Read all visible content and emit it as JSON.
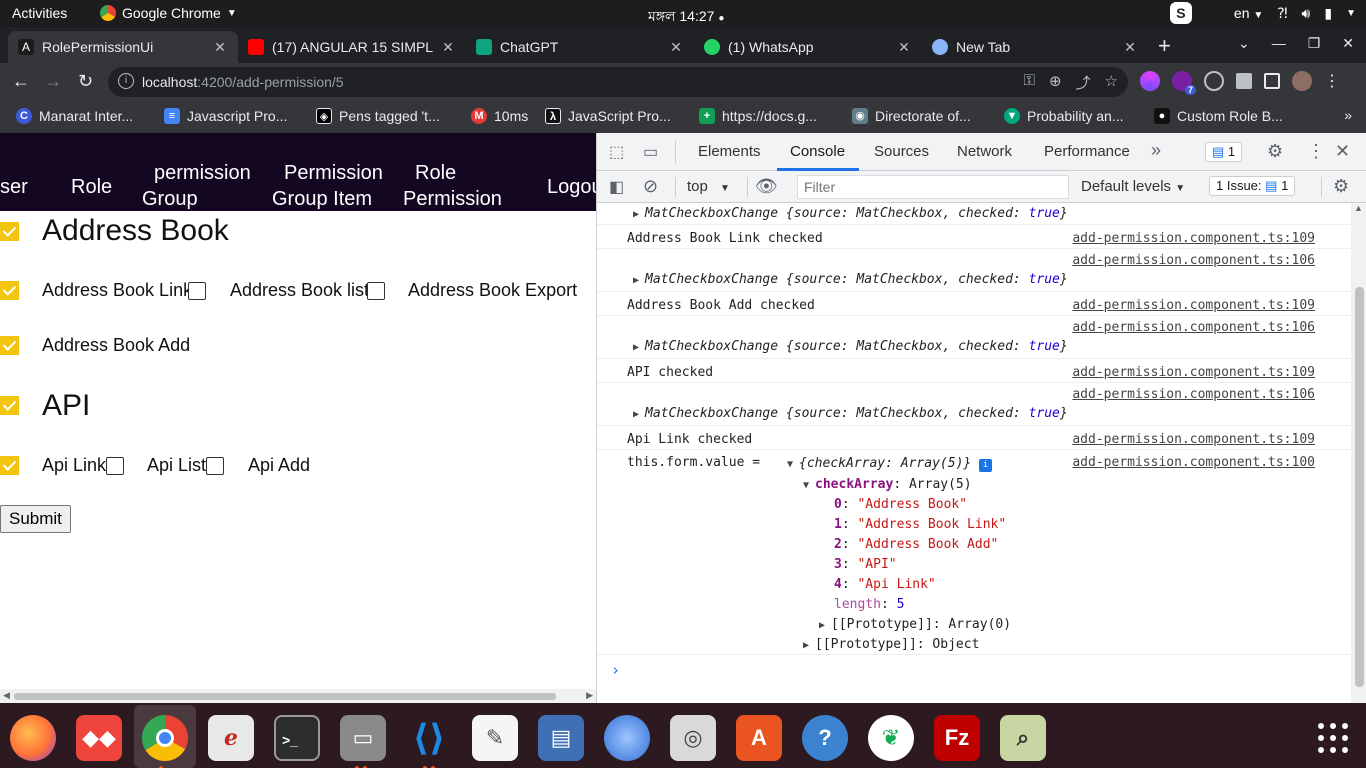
{
  "system": {
    "activities": "Activities",
    "app_name": "Google Chrome",
    "clock": "মঙ্গল 14:27",
    "lang": "en",
    "s_badge": "S"
  },
  "tabs": [
    {
      "title": "RolePermissionUi",
      "favicon": "angular-icon",
      "color": "#c3002f"
    },
    {
      "title": "(17) ANGULAR 15 SIMPL",
      "favicon": "youtube-icon",
      "color": "#ff0000"
    },
    {
      "title": "ChatGPT",
      "favicon": "chatgpt-icon",
      "color": "#10a37f"
    },
    {
      "title": "(1) WhatsApp",
      "favicon": "whatsapp-icon",
      "color": "#25d366"
    },
    {
      "title": "New Tab",
      "favicon": "chrome-icon",
      "color": "#8ab4f8"
    }
  ],
  "toolbar": {
    "url_host": "localhost",
    "url_path": ":4200/add-permission/5",
    "ext_badge": "7"
  },
  "bookmarks": [
    {
      "label": "Manarat Inter...",
      "icon": "C",
      "color": "#3b5bdb"
    },
    {
      "label": "Javascript Pro...",
      "icon": "≡",
      "color": "#4285f4"
    },
    {
      "label": "Pens tagged 't...",
      "icon": "◈",
      "color": "#000000"
    },
    {
      "label": "10ms",
      "icon": "M",
      "color": "#e53935"
    },
    {
      "label": "JavaScript Pro...",
      "icon": "λ",
      "color": "#111111"
    },
    {
      "label": "https://docs.g...",
      "icon": "+",
      "color": "#0f9d58"
    },
    {
      "label": "Directorate of...",
      "icon": "◉",
      "color": "#607d8b"
    },
    {
      "label": "Probability an...",
      "icon": "▼",
      "color": "#00a67e"
    },
    {
      "label": "Custom Role B...",
      "icon": "●",
      "color": "#111111"
    }
  ],
  "app_nav": {
    "user": "ser",
    "role": "Role",
    "permission_group_1": "permission",
    "permission_group_2": "Group",
    "permission_group_item_1": "Permission",
    "permission_group_item_2": "Group Item",
    "role_permission_1": "Role",
    "role_permission_2": "Permission",
    "logout": "Logou"
  },
  "form": {
    "section1_title": "Address Book",
    "address_book_link": "Address Book Link",
    "address_book_list": "Address Book list",
    "address_book_export": "Address Book Export",
    "address_book_add": "Address Book Add",
    "section2_title": "API",
    "api_link": "Api Link",
    "api_list": "Api List",
    "api_add": "Api Add",
    "submit": "Submit"
  },
  "devtools": {
    "tabs": [
      "Elements",
      "Console",
      "Sources",
      "Network",
      "Performance"
    ],
    "active_tab": "Console",
    "message_count": "1",
    "context": "top",
    "filter_placeholder": "Filter",
    "levels": "Default levels",
    "issues": "1 Issue:",
    "issues_count": "1"
  },
  "console": {
    "event_prefix": "MatCheckboxChange",
    "event_body_a": "{source: MatCheckbox, checked: ",
    "event_true": "true",
    "event_close": "}",
    "msg1": "Address Book Link checked",
    "msg2": "Address Book Add checked",
    "msg3": "API checked",
    "msg4": "Api Link checked",
    "src109": "add-permission.component.ts:109",
    "src106": "add-permission.component.ts:106",
    "src100": "add-permission.component.ts:100",
    "form_label": "this.form.value =",
    "obj_summary": "{checkArray: Array(5)}",
    "check_key": "checkArray",
    "check_type": "Array(5)",
    "items": [
      {
        "i": "0",
        "v": "\"Address Book\""
      },
      {
        "i": "1",
        "v": "\"Address Book Link\""
      },
      {
        "i": "2",
        "v": "\"Address Book Add\""
      },
      {
        "i": "3",
        "v": "\"API\""
      },
      {
        "i": "4",
        "v": "\"Api Link\""
      }
    ],
    "length_key": "length",
    "length_val": "5",
    "proto_array": "[[Prototype]]: Array(0)",
    "proto_object": "[[Prototype]]: Object"
  },
  "dock": [
    {
      "name": "firefox-icon",
      "color": "#ff7139"
    },
    {
      "name": "anydesk-icon",
      "color": "#ef443b"
    },
    {
      "name": "chrome-icon",
      "color": "#4285f4"
    },
    {
      "name": "pdf-reader-icon",
      "color": "#e8e8e8"
    },
    {
      "name": "terminal-icon",
      "color": "#2d2d2d"
    },
    {
      "name": "files-icon",
      "color": "#8a8a8a"
    },
    {
      "name": "vscode-icon",
      "color": "#1e88e5"
    },
    {
      "name": "text-editor-icon",
      "color": "#f5f5f5"
    },
    {
      "name": "document-viewer-icon",
      "color": "#3f6fb5"
    },
    {
      "name": "thunderbird-icon",
      "color": "#2f6fd6"
    },
    {
      "name": "rhythmbox-icon",
      "color": "#d9d9d9"
    },
    {
      "name": "software-store-icon",
      "color": "#e95420"
    },
    {
      "name": "help-icon",
      "color": "#3b82d0"
    },
    {
      "name": "mongodb-compass-icon",
      "color": "#00ed64"
    },
    {
      "name": "filezilla-icon",
      "color": "#bf0000"
    },
    {
      "name": "image-viewer-icon",
      "color": "#c9d6a3"
    }
  ]
}
